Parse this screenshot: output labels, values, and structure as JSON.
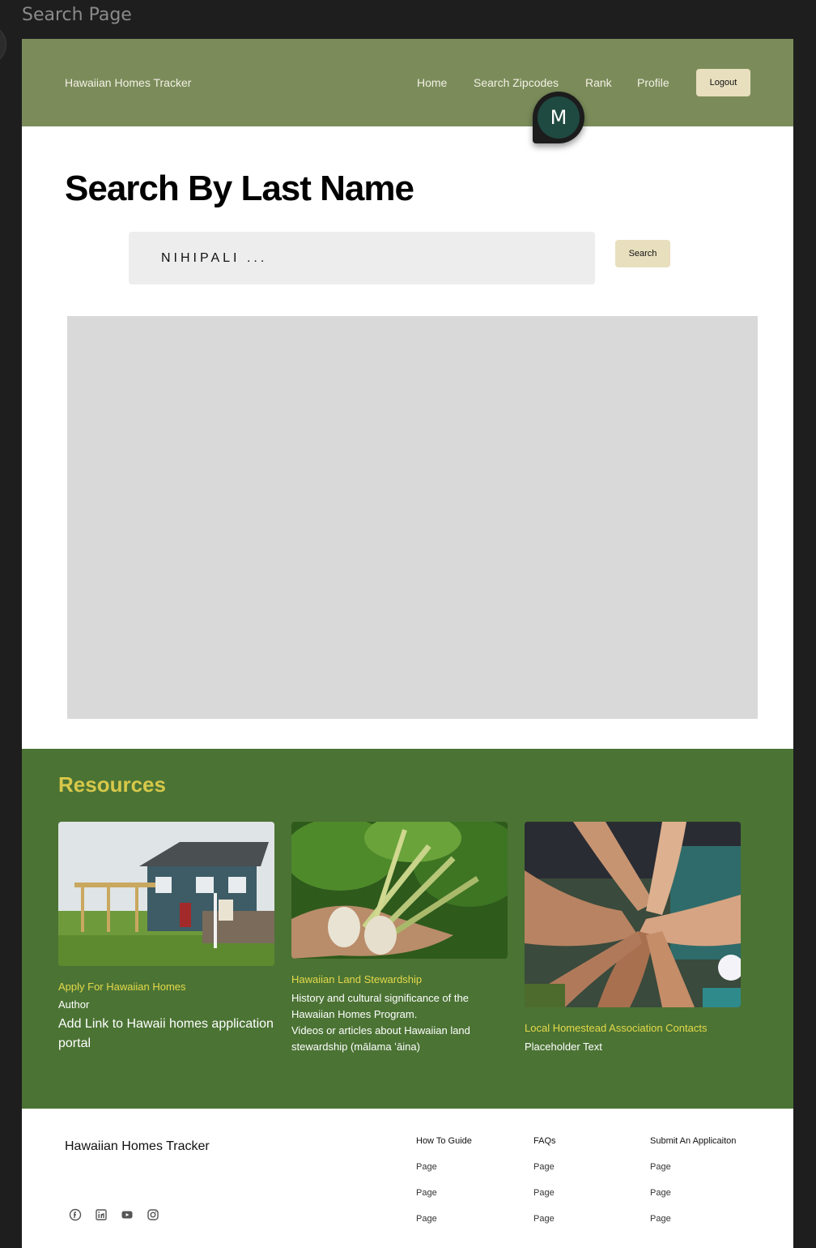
{
  "frame": {
    "title": "Search Page"
  },
  "header": {
    "brand": "Hawaiian Homes Tracker",
    "nav": [
      "Home",
      "Search Zipcodes",
      "Rank",
      "Profile"
    ],
    "logout": "Logout",
    "avatar_initial": "M"
  },
  "main": {
    "title": "Search By Last Name",
    "search_value": "NIHIPALI ...",
    "search_button": "Search"
  },
  "resources": {
    "title": "Resources",
    "cards": [
      {
        "link": "Apply For Hawaiian Homes",
        "author": "Author",
        "body": "Add Link to Hawaii homes application portal"
      },
      {
        "link": "Hawaiian Land Stewardship",
        "body1": "History and cultural significance of the Hawaiian Homes Program.",
        "body2": "Videos or articles about Hawaiian land stewardship (mālama ʻāina)"
      },
      {
        "link": "Local Homestead Association Contacts",
        "body": "Placeholder Text"
      }
    ]
  },
  "footer": {
    "brand": "Hawaiian Homes Tracker",
    "columns": [
      {
        "head": "How To Guide",
        "items": [
          "Page",
          "Page",
          "Page"
        ]
      },
      {
        "head": "FAQs",
        "items": [
          "Page",
          "Page",
          "Page"
        ]
      },
      {
        "head": "Submit An Applicaiton",
        "items": [
          "Page",
          "Page",
          "Page"
        ]
      }
    ],
    "social_icons": [
      "facebook-icon",
      "linkedin-icon",
      "youtube-icon",
      "instagram-icon"
    ]
  },
  "colors": {
    "header": "#7b8c5a",
    "resources": "#4b7334",
    "accent_yellow": "#e4d94a",
    "button": "#e8dfbe"
  }
}
